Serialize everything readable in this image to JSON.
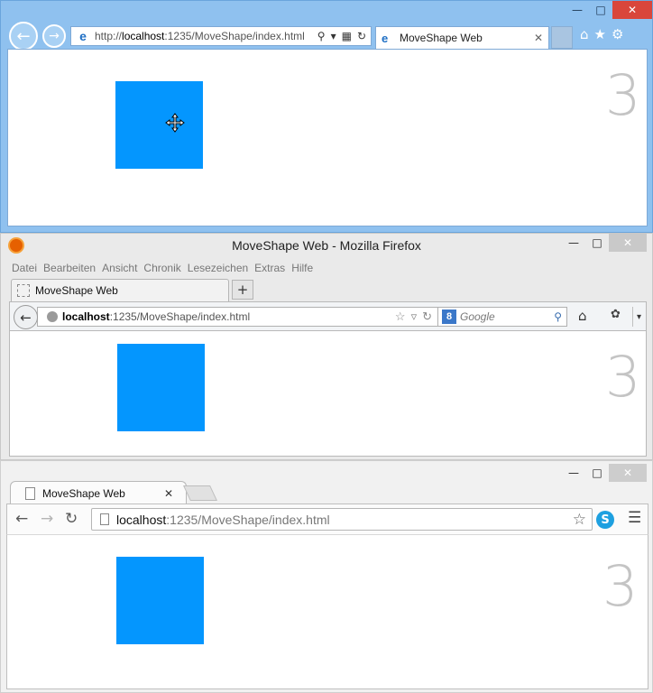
{
  "colors": {
    "shape": "#0496fe",
    "counter": "#c4c4c4"
  },
  "ie": {
    "url_prefix": "http://",
    "url_host": "localhost",
    "url_path": ":1235/MoveShape/index.html",
    "tab_title": "MoveShape Web",
    "counter": "3",
    "icons": [
      "back-icon",
      "forward-icon",
      "search-icon",
      "compat-view-icon",
      "refresh-icon",
      "home-icon",
      "favorites-star-icon",
      "gear-icon",
      "move-cursor-icon"
    ]
  },
  "firefox": {
    "window_title": "MoveShape Web - Mozilla Firefox",
    "menu": [
      "Datei",
      "Bearbeiten",
      "Ansicht",
      "Chronik",
      "Lesezeichen",
      "Extras",
      "Hilfe"
    ],
    "tab_title": "MoveShape Web",
    "new_tab_label": "+",
    "url_host": "localhost",
    "url_path": ":1235/MoveShape/index.html",
    "search_placeholder": "Google",
    "search_engine_badge": "8",
    "counter": "3",
    "icons": [
      "firefox-logo-icon",
      "back-icon",
      "globe-icon",
      "bookmark-star-icon",
      "dropdown-icon",
      "reload-icon",
      "search-icon",
      "home-icon",
      "addon-icon"
    ]
  },
  "chrome": {
    "tab_title": "MoveShape Web",
    "url_host": "localhost",
    "url_path": ":1235/MoveShape/index.html",
    "skype_badge": "S",
    "counter": "3",
    "icons": [
      "page-icon",
      "back-icon",
      "forward-icon",
      "reload-icon",
      "bookmark-star-icon",
      "skype-icon",
      "menu-icon"
    ]
  }
}
